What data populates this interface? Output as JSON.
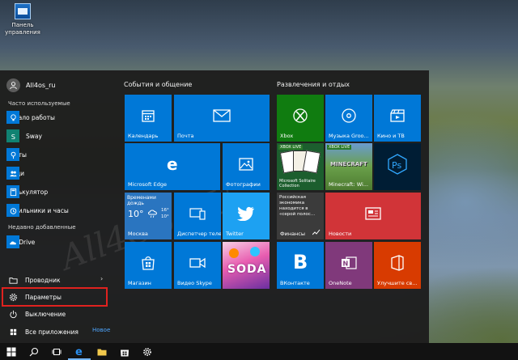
{
  "desktop": {
    "icon_label": "Панель управления"
  },
  "start_menu": {
    "user_name": "All4os_ru",
    "most_used_label": "Часто используемые",
    "most_used": [
      {
        "label": "Начало работы",
        "icon": "lightbulb-icon"
      },
      {
        "label": "Sway",
        "icon": "sway-icon"
      },
      {
        "label": "Карты",
        "icon": "maps-icon"
      },
      {
        "label": "Люди",
        "icon": "people-icon"
      },
      {
        "label": "Калькулятор",
        "icon": "calculator-icon"
      },
      {
        "label": "Будильники и часы",
        "icon": "alarm-icon"
      }
    ],
    "recently_added_label": "Недавно добавленные",
    "recently_added": [
      {
        "label": "OneDrive",
        "icon": "onedrive-icon"
      }
    ],
    "bottom": {
      "explorer": "Проводник",
      "settings": "Параметры",
      "power": "Выключение",
      "all_apps": "Все приложения",
      "new_badge": "Новое"
    },
    "groups": {
      "left_title": "События и общение",
      "right_title": "Развлечения и отдых"
    },
    "tiles": {
      "calendar": "Календарь",
      "mail": "Почта",
      "edge": "Microsoft Edge",
      "photos": "Фотографии",
      "weather_title": "Временами дождь",
      "weather_temp": "10°",
      "weather_high": "16°",
      "weather_low": "10°",
      "weather_city": "Москва",
      "device_manager": "Диспетчер теле...",
      "twitter": "Twitter",
      "store": "Магазин",
      "skype": "Видео Skype",
      "candy": "SODA",
      "xbox": "Xbox",
      "groove": "Музыка Groo...",
      "movies": "Кино и ТВ",
      "xbox_live_1": "XBOX LIVE",
      "solitaire": "Microsoft Solitaire Collection",
      "xbox_live_2": "XBOX LIVE",
      "minecraft": "MINECRAFT",
      "minecraft_sub": "Minecraft: Wi...",
      "finance_news": "Российская экономика находится в «серой полос...",
      "finance": "Финансы",
      "news": "Новости",
      "vk": "ВКонтакте",
      "onenote": "OneNote",
      "office": "Улучшите св..."
    },
    "watermark": "All4OS.RU"
  },
  "colors": {
    "tile_blue": "#0078d7",
    "xbox_green": "#107c10",
    "news_red": "#d13438",
    "onenote_purple": "#80397b",
    "office_red": "#d83b01",
    "ps_dark": "#001d34",
    "vk_blue": "#0078d7",
    "highlight": "#e0221f"
  }
}
